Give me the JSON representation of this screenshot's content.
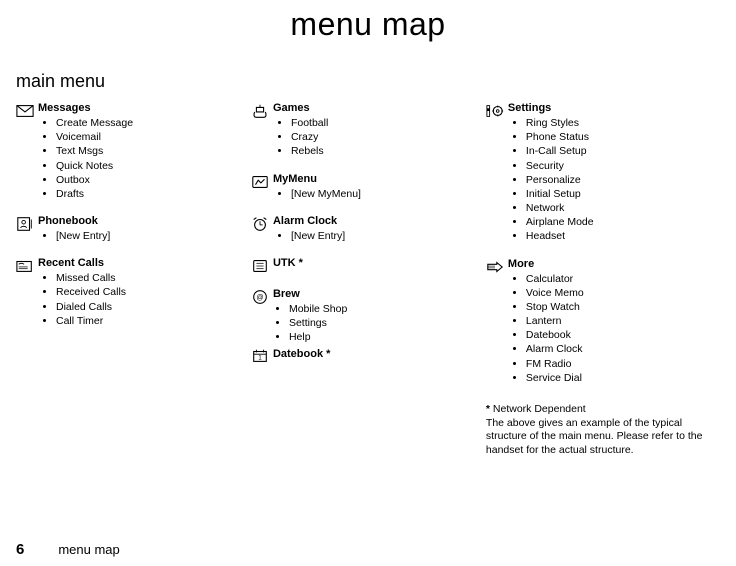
{
  "page": {
    "title": "menu map",
    "section": "main menu",
    "footer_num": "6",
    "footer_label": "menu map"
  },
  "col1": {
    "messages": {
      "title": "Messages",
      "items": [
        "Create Message",
        "Voicemail",
        "Text Msgs",
        "Quick Notes",
        "Outbox",
        "Drafts"
      ]
    },
    "phonebook": {
      "title": "Phonebook",
      "items": [
        "[New Entry]"
      ]
    },
    "recent": {
      "title": "Recent Calls",
      "items": [
        "Missed Calls",
        "Received Calls",
        "Dialed Calls",
        "Call Timer"
      ]
    }
  },
  "col2": {
    "games": {
      "title": "Games",
      "items": [
        "Football",
        "Crazy",
        "Rebels"
      ]
    },
    "mymenu": {
      "title": "MyMenu",
      "items": [
        "[New MyMenu]"
      ]
    },
    "alarm": {
      "title": "Alarm Clock",
      "items": [
        "[New Entry]"
      ]
    },
    "utk": {
      "title": "UTK *"
    },
    "brew": {
      "title": "Brew",
      "items": [
        "Mobile Shop",
        "Settings",
        "Help"
      ]
    },
    "datebook": {
      "title": "Datebook *"
    }
  },
  "col3": {
    "settings": {
      "title": "Settings",
      "items": [
        "Ring Styles",
        "Phone Status",
        "In-Call Setup",
        "Security",
        "Personalize",
        "Initial Setup",
        "Network",
        "Airplane Mode",
        "Headset"
      ]
    },
    "more": {
      "title": "More",
      "items": [
        "Calculator",
        "Voice Memo",
        "Stop Watch",
        "Lantern",
        "Datebook",
        "Alarm Clock",
        "FM Radio",
        "Service Dial"
      ]
    }
  },
  "footnote": {
    "star": "*",
    "star_text": " Network Dependent",
    "body": "The above gives an example of the typical structure of the main menu. Please refer to the handset for the actual structure."
  }
}
